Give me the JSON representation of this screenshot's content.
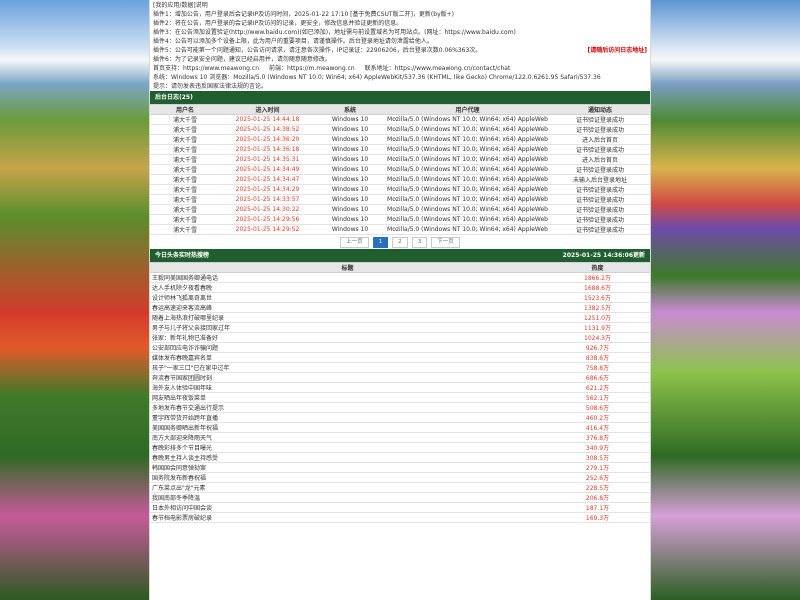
{
  "top_info": {
    "lines": [
      "[我的应用/数据]说明",
      "插件1：增加公告，用户登录后会记录IP及访问时间，2025-01-22 17:10 [基于免费CSUT版二开]，更新(by版+)",
      "插件2：将在公告，用户登录的会记录IP及访问的记录，更安全，修改信息并验证更新的信息。",
      "插件3：在公告添加设置验证(http://www.baidu.com)(如已添加)，地址需与前设置域名为可用站点。(网址：https://www.baidu.com)",
      "插件4：公告可以添加多个设备上限，此为用户的重要项目，请谨慎操作。后台登录地址请勿泄露给他人。",
      "插件5：公告可能第一个问题通知，公告访问请求，请注意各次操作，IP记录证：22906206，后台登录次数0.06%363次。",
      "插件6：为了记录安全问题，建议已经启用并，请勿随意随意修改。"
    ],
    "warn": "[请随后访问日志地址]",
    "kvs": [
      "首页支持：https://www.meawong.cn",
      "前端：https://m.meawong.cn",
      "联系地址：https://www.meawong.cn/contact/chat"
    ],
    "ua_line": "系统：Windows 10  浏览器：Mozilla/5.0 (Windows NT 10.0; Win64; x64) AppleWebKit/537.36 (KHTML, like Gecko) Chrome/122.0.6261.95 Safari/537.36",
    "misc_line": "提示：请勿发表违反国家法律法规的言论。"
  },
  "login_log": {
    "header_left": "后台日志(25)",
    "columns": [
      "用户名",
      "进入时间",
      "系统",
      "用户代理",
      "通知动态"
    ],
    "rows": [
      [
        "浦大千雪",
        "2025-01-25 14:44:18",
        "Windows 10",
        "Mozilla/5.0 (Windows NT 10.0; Win64; x64) AppleWeb",
        "证书验证登录成功"
      ],
      [
        "浦大千雪",
        "2025-01-25 14:38:52",
        "Windows 10",
        "Mozilla/5.0 (Windows NT 10.0; Win64; x64) AppleWeb",
        "证书验证登录成功"
      ],
      [
        "浦大千雪",
        "2025-01-25 14:36:20",
        "Windows 10",
        "Mozilla/5.0 (Windows NT 10.0; Win64; x64) AppleWeb",
        "进入后台首页"
      ],
      [
        "浦大千雪",
        "2025-01-25 14:36:18",
        "Windows 10",
        "Mozilla/5.0 (Windows NT 10.0; Win64; x64) AppleWeb",
        "证书验证登录成功"
      ],
      [
        "浦大千雪",
        "2025-01-25 14:35:31",
        "Windows 10",
        "Mozilla/5.0 (Windows NT 10.0; Win64; x64) AppleWeb",
        "进入后台首页"
      ],
      [
        "浦大千雪",
        "2025-01-25 14:34:49",
        "Windows 10",
        "Mozilla/5.0 (Windows NT 10.0; Win64; x64) AppleWeb",
        "证书验证登录成功"
      ],
      [
        "浦大千雪",
        "2025-01-25 14:34:47",
        "Windows 10",
        "Mozilla/5.0 (Windows NT 10.0; Win64; x64) AppleWeb",
        "未输入后台登录地址"
      ],
      [
        "浦大千雪",
        "2025-01-25 14:34:29",
        "Windows 10",
        "Mozilla/5.0 (Windows NT 10.0; Win64; x64) AppleWeb",
        "证书验证登录成功"
      ],
      [
        "浦大千雪",
        "2025-01-25 14:33:57",
        "Windows 10",
        "Mozilla/5.0 (Windows NT 10.0; Win64; x64) AppleWeb",
        "证书验证登录成功"
      ],
      [
        "浦大千雪",
        "2025-01-25 14:30:22",
        "Windows 10",
        "Mozilla/5.0 (Windows NT 10.0; Win64; x64) AppleWeb",
        "证书验证登录成功"
      ],
      [
        "浦大千雪",
        "2025-01-25 14:29:56",
        "Windows 10",
        "Mozilla/5.0 (Windows NT 10.0; Win64; x64) AppleWeb",
        "证书验证登录成功"
      ],
      [
        "浦大千雪",
        "2025-01-25 14:29:52",
        "Windows 10",
        "Mozilla/5.0 (Windows NT 10.0; Win64; x64) AppleWeb",
        "证书验证登录成功"
      ]
    ],
    "pagination": [
      "上一页",
      "1",
      "2",
      "3",
      "下一页"
    ],
    "active_page": "1"
  },
  "hot_list": {
    "header_left": "今日头条实时热搜榜",
    "header_right": "2025-01-25 14:36:06更新",
    "columns": [
      "标题",
      "热度"
    ],
    "rows": [
      [
        "王毅同美国国务卿通电话",
        "1866.2万"
      ],
      [
        "达人手机除夕夜看春晚",
        "1688.6万"
      ],
      [
        "设计师林飞狐离奇离世",
        "1523.6万"
      ],
      [
        "春运高速迎来客流高峰",
        "1382.5万"
      ],
      [
        "随着上海热浪打破哪里纪录",
        "1251.0万"
      ],
      [
        "男子与儿子将父亲接回家过年",
        "1131.9万"
      ],
      [
        "张家：新年礼物已准备好",
        "1024.3万"
      ],
      [
        "公安部回应电诈诈骗问题",
        "926.7万"
      ],
      [
        "媒体发布春晚嘉宾名单",
        "838.6万"
      ],
      [
        "孩子\"一家三口\"已在家中过年",
        "758.8万"
      ],
      [
        "奔流春节国家团圆时刻",
        "686.6万"
      ],
      [
        "海外友人体验中国年味",
        "621.2万"
      ],
      [
        "网友晒出年夜饭菜单",
        "562.1万"
      ],
      [
        "多地发布春节交通出行提示",
        "508.6万"
      ],
      [
        "董宇辉带货开始跨年直播",
        "460.2万"
      ],
      [
        "美国国务卿晒出新年祝福",
        "416.4万"
      ],
      [
        "南方大部迎来降雨天气",
        "376.8万"
      ],
      [
        "春晚彩排多个节目曝光",
        "340.9万"
      ],
      [
        "春晚男主持人谈主持感受",
        "308.5万"
      ],
      [
        "韩国国会同意弹劾案",
        "279.1万"
      ],
      [
        "国务院发布新春祝福",
        "252.6万"
      ],
      [
        "广东菜点出\"龙\"元素",
        "228.5万"
      ],
      [
        "我国南部冬季降温",
        "206.8万"
      ],
      [
        "日本外相访问中国会谈",
        "187.1万"
      ],
      [
        "春节档电影票房破纪录",
        "169.3万"
      ]
    ]
  },
  "colors": {
    "header_green": "#1f5f2f",
    "time_red": "#e03b24",
    "page_blue": "#2a6fbd"
  }
}
